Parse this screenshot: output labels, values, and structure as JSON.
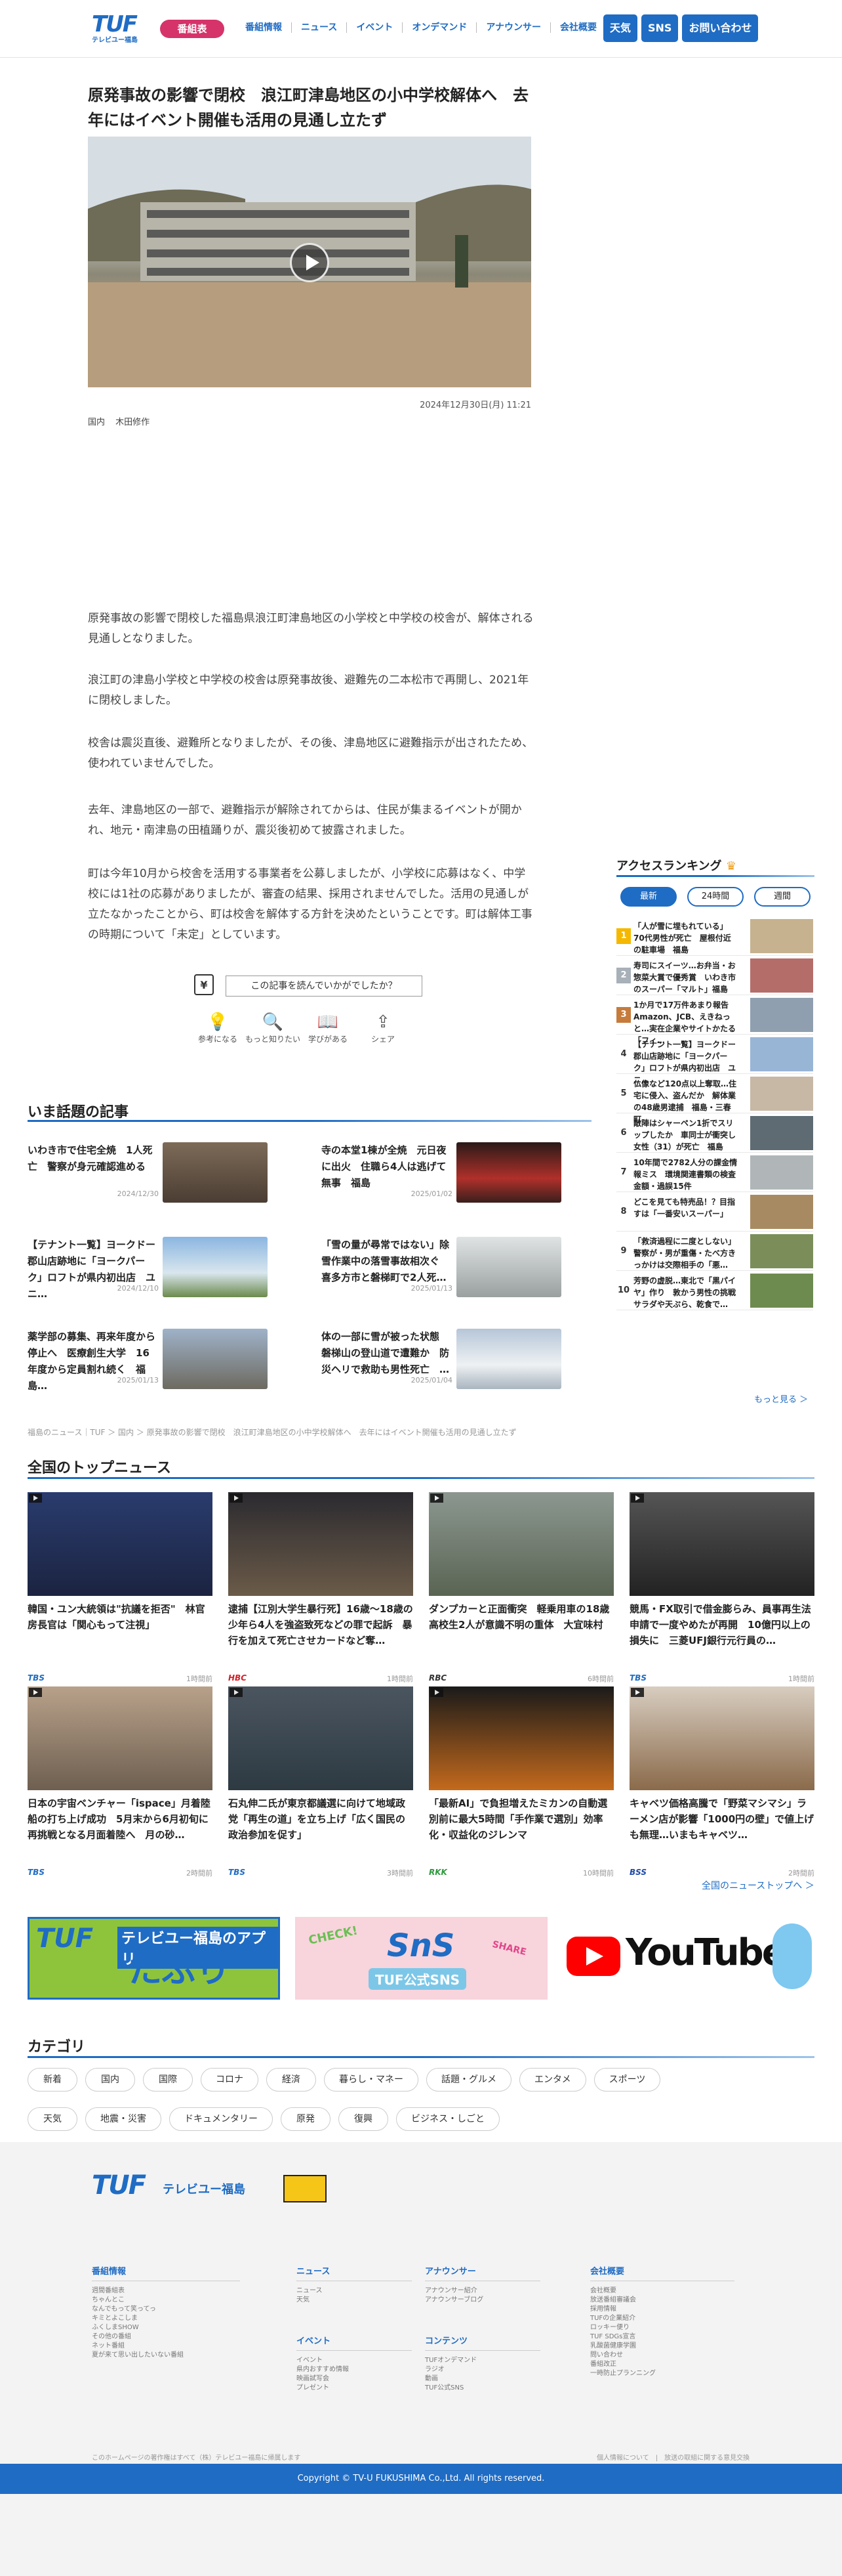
{
  "header": {
    "logo": "TUF",
    "logo_sub": "テレビユー福島",
    "program_btn": "番組表",
    "nav": [
      "番組情報",
      "ニュース",
      "イベント",
      "オンデマンド",
      "アナウンサー",
      "会社概要"
    ],
    "buttons": [
      "天気",
      "SNS",
      "お問い合わせ"
    ]
  },
  "article": {
    "title": "原発事故の影響で閉校　浪江町津島地区の小中学校解体へ　去年にはイベント開催も活用の見通し立たず",
    "date": "2024年12月30日(月) 11:21",
    "category": "国内",
    "author": "木田修作",
    "paragraphs": [
      "原発事故の影響で閉校した福島県浪江町津島地区の小学校と中学校の校舎が、解体される見通しとなりました。",
      "浪江町の津島小学校と中学校の校舎は原発事故後、避難先の二本松市で再開し、2021年に閉校しました。",
      "校舎は震災直後、避難所となりましたが、その後、津島地区に避難指示が出されたため、使われていませんでした。",
      "去年、津島地区の一部で、避難指示が解除されてからは、住民が集まるイベントが開かれ、地元・南津島の田植踊りが、震災後初めて披露されました。",
      "町は今年10月から校舎を活用する事業者を公募しましたが、小学校に応募はなく、中学校には1社の応募がありましたが、審査の結果、採用されませんでした。活用の見通しが立たなかったことから、町は校舎を解体する方針を決めたということです。町は解体工事の時期について「未定」としています。"
    ],
    "question": "この記事を読んでいかがでしたか？",
    "reactions": [
      {
        "icon": "bulb-icon",
        "glyph": "💡",
        "label": "参考になる"
      },
      {
        "icon": "search-icon",
        "glyph": "🔍",
        "label": "もっと知りたい"
      },
      {
        "icon": "book-icon",
        "glyph": "📖",
        "label": "学びがある"
      },
      {
        "icon": "share-icon",
        "glyph": "⇪",
        "label": "シェア"
      }
    ]
  },
  "hot": {
    "title": "いま話題の記事",
    "items": [
      {
        "title": "いわき市で住宅全焼　1人死亡　警察が身元確認進める",
        "date": "2024/12/30"
      },
      {
        "title": "寺の本堂1棟が全焼　元日夜に出火　住職ら4人は逃げて無事　福島",
        "date": "2025/01/02"
      },
      {
        "title": "【テナント一覧】ヨークドー郡山店跡地に「ヨークパーク」ロフトが県内初出店　ユニ…",
        "date": "2024/12/10"
      },
      {
        "title": "「雪の量が尋常ではない」除雪作業中の落雪事故相次ぐ　喜多方市と磐梯町で2人死…",
        "date": "2025/01/13"
      },
      {
        "title": "薬学部の募集、再来年度から停止へ　医療創生大学　16年度から定員割れ続く　福島…",
        "date": "2025/01/13"
      },
      {
        "title": "体の一部に雪が被った状態　磐梯山の登山道で遭難か　防災ヘリで救助も男性死亡　…",
        "date": "2025/01/04"
      }
    ]
  },
  "breadcrumb": "福島のニュース｜TUF ＞ 国内 ＞ 原発事故の影響で閉校　浪江町津島地区の小中学校解体へ　去年にはイベント開催も活用の見通し立たず",
  "ranking": {
    "title": "アクセスランキング",
    "tabs": [
      "最新",
      "24時間",
      "週間"
    ],
    "more": "もっと見る ＞",
    "items": [
      "「人が雪に埋もれている」70代男性が死亡　屋根付近の駐車場　福島",
      "寿司にスイーツ…お弁当・お惣菜大賞で優秀賞　いわき市のスーパー「マルト」福島",
      "1か月で17万件あまり報告　Amazon、JCB、えきねっと…実在企業やサイトかたる「フィ…",
      "【テナント一覧】ヨークドー郡山店跡地に「ヨークパーク」ロフトが県内初出店　ユニ…",
      "仏像など120点以上奪取…住宅に侵入、盗んだか　解体業の48歳男逮捕　福島・三春町",
      "敵陣はシャーペン1折でスリップしたか　車同士が衝突し女性（31）が死亡　福島",
      "10年間で2782人分の課金情報ミス　環境関連書類の検査金額・過誤15件",
      "どこを見ても特売品！？目指すは「一番安いスーパー」",
      "「救済過程に二度としない」警察が・男が重傷・たべ方きっかけは交際相手の「悪…",
      "芳野の虚脱…東北で「黒パイヤ」作り　敦かう男性の挑戦　サラダや天ぷら、乾食で…"
    ]
  },
  "national": {
    "title": "全国のトップニュース",
    "more": "全国のニューストップへ ＞",
    "items": [
      {
        "title": "韓国・ユン大統領は\"抗議を拒否\"　林官房長官は「関心もって注視」",
        "src": "TBS",
        "ago": "1時間前"
      },
      {
        "title": "逮捕【江別大学生暴行死】16歳〜18歳の少年ら4人を強盗致死などの罪で起訴　暴行を加えて死亡させカードなど奪…",
        "src": "HBC",
        "ago": "1時間前"
      },
      {
        "title": "ダンプカーと正面衝突　軽乗用車の18歳高校生2人が意識不明の重体　大宜味村",
        "src": "RBC",
        "ago": "6時間前"
      },
      {
        "title": "競馬・FX取引で借金膨らみ、員事再生法申請で一度やめたが再開　10億円以上の損失に　三菱UFJ銀行元行員の…",
        "src": "TBS",
        "ago": "1時間前"
      },
      {
        "title": "日本の宇宙ベンチャー「ispace」月着陸船の打ち上げ成功　5月末から6月初旬に再挑戦となる月面着陸へ　月の砂…",
        "src": "TBS",
        "ago": "2時間前"
      },
      {
        "title": "石丸伸二氏が東京都議選に向けて地域政党「再生の道」を立ち上げ「広く国民の政治参加を促す」",
        "src": "TBS",
        "ago": "3時間前"
      },
      {
        "title": "「最新AI」で負担増えたミカンの自動選別前に最大5時間「手作業で選別」効率化・収益化のジレンマ",
        "src": "RKK",
        "ago": "10時間前"
      },
      {
        "title": "キャベツ価格高騰で「野菜マシマシ」ラーメン店が影響「1000円の壁」で値上げも無理…いまもキャベツ…",
        "src": "BSS",
        "ago": "2時間前"
      }
    ]
  },
  "banners": {
    "app_line1": "テレビユー福島のアプリ",
    "app_line2": "たぷり",
    "sns_line1": "SnS",
    "sns_line2": "TUF公式SNS",
    "sns_check": "CHECK!",
    "sns_share": "SHARE",
    "youtube": "YouTube"
  },
  "categories": {
    "title": "カテゴリ",
    "items": [
      "新着",
      "国内",
      "国際",
      "コロナ",
      "経済",
      "暮らし・マネー",
      "話題・グルメ",
      "エンタメ",
      "スポーツ",
      "天気",
      "地震・災害",
      "ドキュメンタリー",
      "原発",
      "復興",
      "ビジネス・しごと"
    ]
  },
  "footer": {
    "logo": "TUF",
    "logo_sub": "テレビユー福島",
    "cols": [
      {
        "title": "番組情報",
        "items": [
          "週間番組表",
          "ちゃんとこ",
          "なんでもって笑ってっ",
          "キミとよこしま",
          "ふくしまSHOW",
          "その他の番組",
          "ネット番組",
          "夏が来て思い出したいない番組"
        ]
      },
      {
        "title": "ニュース",
        "items": [
          "ニュース",
          "天気"
        ]
      },
      {
        "title": "イベント",
        "items": [
          "イベント",
          "県内おすすめ情報",
          "映画試写会",
          "プレゼント"
        ]
      },
      {
        "title": "アナウンサー",
        "items": [
          "アナウンサー紹介",
          "アナウンサーブログ"
        ]
      },
      {
        "title": "コンテンツ",
        "items": [
          "TUFオンデマンド",
          "ラジオ",
          "動画",
          "TUF公式SNS"
        ]
      },
      {
        "title": "会社概要",
        "items": [
          "会社概要",
          "放送番組審議会",
          "採用情報",
          "TUFの企業紹介",
          "ロッキー便り",
          "TUF SDGs宣言",
          "乳酸菌健康学園",
          "問い合わせ",
          "番組改正",
          "一時防止プランニング"
        ]
      }
    ],
    "notice": "このホームページの著作権はすべて（株）テレビユー福島に帰属します",
    "links": "個人情報について　|　放送の取組に関する意見交換",
    "copyright": "Copyright © TV-U FUKUSHIMA Co.,Ltd. All rights reserved."
  }
}
